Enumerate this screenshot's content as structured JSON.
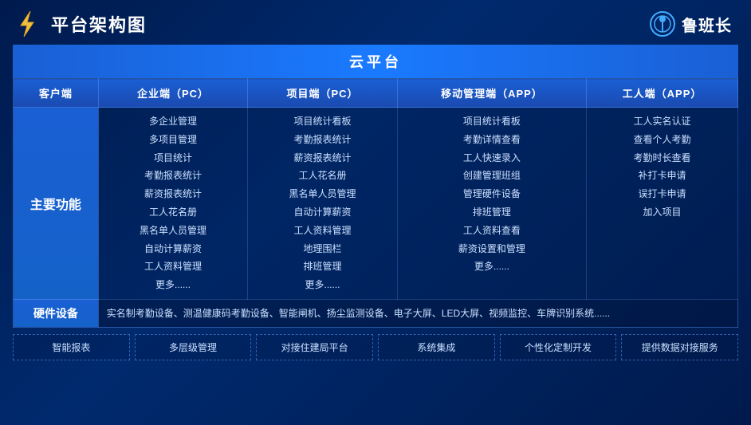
{
  "header": {
    "title": "平台架构图",
    "brand": "鲁班长"
  },
  "cloud": {
    "label": "云平台"
  },
  "columns": {
    "client": "客户端",
    "enterprise": "企业端（PC）",
    "project_pc": "项目端（PC）",
    "mobile": "移动管理端（APP）",
    "worker": "工人端（APP）"
  },
  "main_function": {
    "label": "主要功能",
    "enterprise_items": [
      "多企业管理",
      "多项目管理",
      "项目统计",
      "考勤报表统计",
      "薪资报表统计",
      "工人花名册",
      "黑名单人员管理",
      "自动计算薪资",
      "工人资料管理",
      "更多......"
    ],
    "project_items": [
      "项目统计看板",
      "考勤报表统计",
      "薪资报表统计",
      "工人花名册",
      "黑名单人员管理",
      "自动计算薪资",
      "工人资料管理",
      "地理围栏",
      "排班管理",
      "更多......"
    ],
    "mobile_items": [
      "项目统计看板",
      "考勤详情查看",
      "工人快速录入",
      "创建管理班组",
      "管理硬件设备",
      "排班管理",
      "工人资料查看",
      "薪资设置和管理",
      "更多......"
    ],
    "worker_items": [
      "工人实名认证",
      "查看个人考勤",
      "考勤时长查看",
      "补打卡申请",
      "误打卡申请",
      "加入项目"
    ]
  },
  "hardware": {
    "label": "硬件设备",
    "content": "实名制考勤设备、测温健康码考勤设备、智能闸机、扬尘监测设备、电子大屏、LED大屏、视频监控、车牌识别系统......"
  },
  "features": [
    "智能报表",
    "多层级管理",
    "对接住建局平台",
    "系统集成",
    "个性化定制开发",
    "提供数据对接服务"
  ]
}
